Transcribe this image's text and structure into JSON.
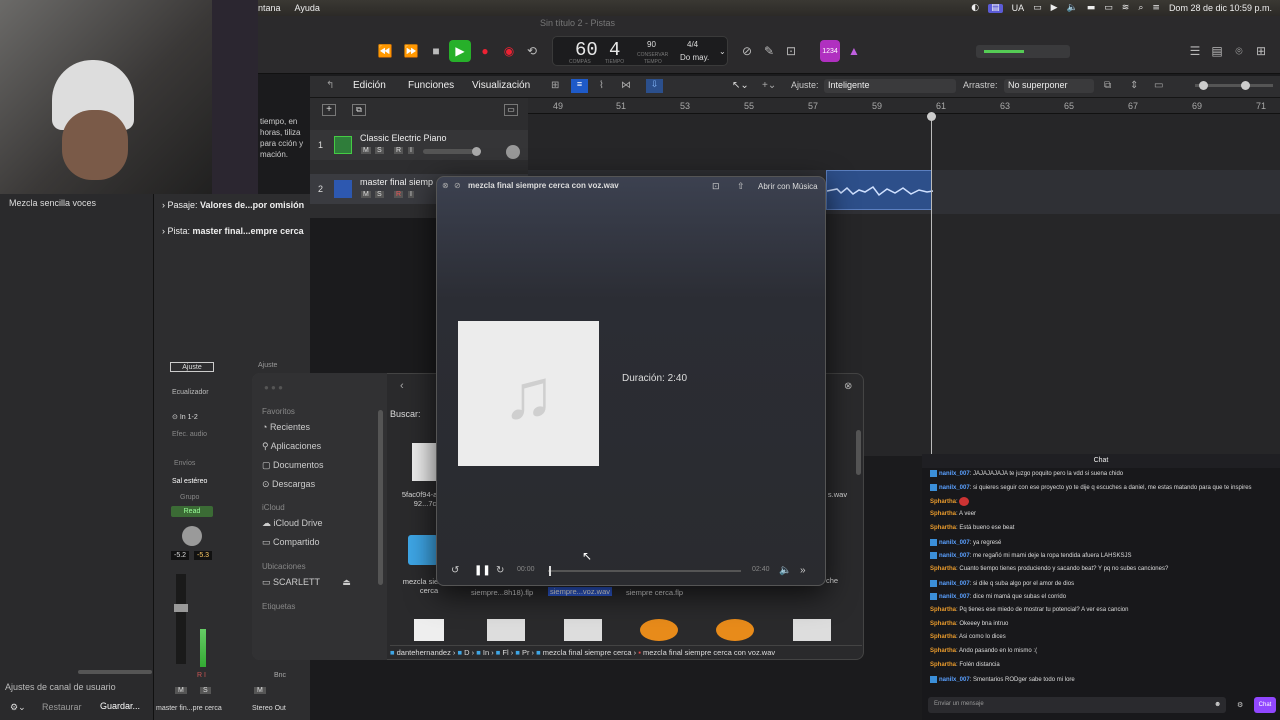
{
  "menubar": {
    "items": [
      "ntana",
      "Ayuda"
    ],
    "lang": "UA",
    "datetime": "Dom 28 de dic 10:59 p.m."
  },
  "window_title": "Sin título 2 - Pistas",
  "lcd": {
    "bar": "60",
    "beat": "4",
    "bar_label": "COMPÁS",
    "beat_label": "TIEMPO",
    "tempo": "90",
    "tempo_label": "CONSERVAR",
    "tempo_sub": "TEMPO",
    "sig": "4/4",
    "key": "Do may."
  },
  "count_in": "1234",
  "ctrlbar": {
    "edit": "Edición",
    "functions": "Funciones",
    "view": "Visualización",
    "snap_label": "Ajuste:",
    "snap_value": "Inteligente",
    "drag_label": "Arrastre:",
    "drag_value": "No superponer"
  },
  "ruler": [
    "49",
    "51",
    "53",
    "55",
    "57",
    "59",
    "61",
    "63",
    "65",
    "67",
    "69",
    "71"
  ],
  "tracks": [
    {
      "num": "1",
      "name": "Classic Electric Piano",
      "m": "M",
      "s": "S",
      "r": "R",
      "i": "I"
    },
    {
      "num": "2",
      "name": "master final siemp",
      "m": "M",
      "s": "S",
      "r": "R",
      "i": "I"
    }
  ],
  "inspector": {
    "patch_name": "Mezcla sencilla voces",
    "passage_label": "Pasaje:",
    "passage_value": "Valores de...por omisión",
    "track_label": "Pista:",
    "track_value": "master final...empre cerca",
    "help_text": "tiempo, en horas, tiliza para cción y mación."
  },
  "channel": {
    "setting": "Ajuste",
    "eq": "Ecualizador",
    "input": "In 1-2",
    "audio_fx": "Efec. audio",
    "send": "Envíos",
    "output": "Sal estéreo",
    "group": "Grupo",
    "read": "Read",
    "pan_left": "-5.2",
    "pan_right": "-5.3",
    "name": "master fin...pre cerca",
    "setting2": "Ajuste",
    "out_name": "Stereo Out",
    "bnc": "Bnc",
    "m": "M",
    "s": "S",
    "m2": "M",
    "channel_settings": "Ajustes de canal de usuario",
    "restore": "Restaurar",
    "save": "Guardar..."
  },
  "quicklook": {
    "title": "mezcla final siempre cerca con voz.wav",
    "open_with": "Abrir con Música",
    "duration": "Duración: 2:40",
    "time_start": "00:00",
    "time_end": "02:40"
  },
  "finder": {
    "search_label": "Buscar:",
    "favorites": "Favoritos",
    "fav_items": [
      "Recientes",
      "Aplicaciones",
      "Documentos",
      "Descargas"
    ],
    "icloud": "iCloud",
    "icloud_items": [
      "iCloud Drive",
      "Compartido"
    ],
    "locations": "Ubicaciones",
    "loc_items": [
      "SCARLETT"
    ],
    "tags": "Etiquetas",
    "files": [
      "5fac0f94-a76-92...7c",
      "mezcla siempre cerca",
      "siempre...8h18).flp",
      "siempre...voz.wav",
      "siempre cerca.flp",
      "al s.wav",
      "che"
    ],
    "path": [
      "dantehernandez",
      "D",
      "In",
      "Fl",
      "Pr",
      "mezcla final siempre cerca",
      "mezcla final siempre cerca con voz.wav"
    ]
  },
  "chat": {
    "title": "Chat",
    "messages": [
      {
        "user": "nanilx_007",
        "text": "JAJAJAJAJA te juzgo poquito pero la vdd si suena chido",
        "color": "#5aa0ff"
      },
      {
        "user": "nanilx_007",
        "text": "si quieres seguir con ese proyecto yo te dije q escuches a daniel, me estas matando para que te inspires",
        "color": "#5aa0ff"
      },
      {
        "user": "Sphartha",
        "text": "",
        "color": "#e89a2c"
      },
      {
        "user": "Sphartha",
        "text": "A veer",
        "color": "#e89a2c"
      },
      {
        "user": "Sphartha",
        "text": "Está bueno ese beat",
        "color": "#e89a2c"
      },
      {
        "user": "nanilx_007",
        "text": "ya regresé",
        "color": "#5aa0ff"
      },
      {
        "user": "nanilx_007",
        "text": "me regañó mi mami deje la ropa tendida afuera LAHSKSJS",
        "color": "#5aa0ff"
      },
      {
        "user": "Sphartha",
        "text": "Cuanto tiempo tienes produciendo y sacando beat? Y pq no subes canciones?",
        "color": "#e89a2c"
      },
      {
        "user": "nanilx_007",
        "text": "si dile q suba algo por el amor de dios",
        "color": "#5aa0ff"
      },
      {
        "user": "nanilx_007",
        "text": "dice mi mamá que subas el corrido",
        "color": "#5aa0ff"
      },
      {
        "user": "Sphartha",
        "text": "Pq tienes ese miedo de mostrar tu potencial? A ver esa cancion",
        "color": "#e89a2c"
      },
      {
        "user": "Sphartha",
        "text": "Okeeey bna intruo",
        "color": "#e89a2c"
      },
      {
        "user": "Sphartha",
        "text": "Asi como lo dices",
        "color": "#e89a2c"
      },
      {
        "user": "Sphartha",
        "text": "Ando pasando en lo mismo :(",
        "color": "#e89a2c"
      },
      {
        "user": "Sphartha",
        "text": "Folén distancia",
        "color": "#e89a2c"
      },
      {
        "user": "nanilx_007",
        "text": "Smentarios RODger sabe todo mi lore",
        "color": "#5aa0ff"
      }
    ],
    "input_placeholder": "Enviar un mensaje",
    "send": "Chat"
  }
}
